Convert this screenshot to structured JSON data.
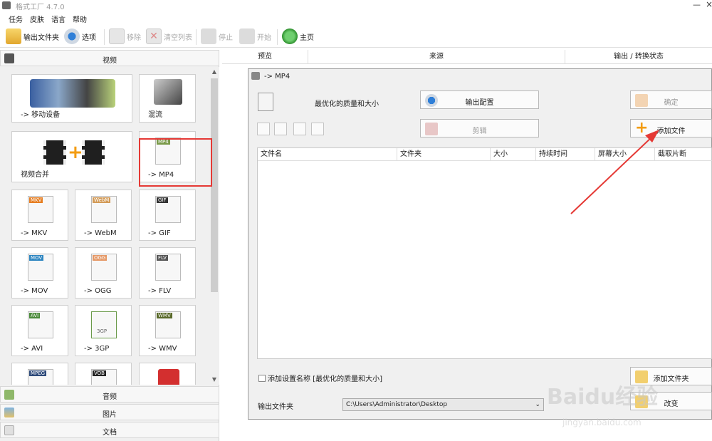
{
  "window": {
    "title": "格式工厂 4.7.0",
    "minimize": "—",
    "close": "×"
  },
  "menu": [
    "任务",
    "皮肤",
    "语言",
    "帮助"
  ],
  "toolbar": {
    "output_folder": "输出文件夹",
    "options": "选项",
    "remove": "移除",
    "clear_list": "清空列表",
    "stop": "停止",
    "start": "开始",
    "home": "主页"
  },
  "left": {
    "video_header": "视频",
    "tiles": [
      {
        "label": "-> 移动设备"
      },
      {
        "label": "混流"
      },
      {
        "label": "视频合并"
      },
      {
        "label": "-> MP4",
        "badge": "MP4"
      },
      {
        "label": "-> MKV",
        "badge": "MKV"
      },
      {
        "label": "-> WebM",
        "badge": "WebM"
      },
      {
        "label": "-> GIF",
        "badge": "GIF"
      },
      {
        "label": "-> MOV",
        "badge": "MOV"
      },
      {
        "label": "-> OGG",
        "badge": "OGG"
      },
      {
        "label": "-> FLV",
        "badge": "FLV"
      },
      {
        "label": "-> AVI",
        "badge": "AVI"
      },
      {
        "label": "-> 3GP",
        "badge": "3GP"
      },
      {
        "label": "-> WMV",
        "badge": "WMV"
      },
      {
        "label": "",
        "badge": "MPEG"
      },
      {
        "label": "",
        "badge": "VOB"
      },
      {
        "label": "",
        "badge": ""
      }
    ],
    "categories": [
      "音频",
      "图片",
      "文档"
    ]
  },
  "columns": [
    "预览",
    "来源",
    "输出 / 转换状态"
  ],
  "dialog": {
    "title": "-> MP4",
    "quality": "最优化的质量和大小",
    "output_config": "输出配置",
    "ok": "确定",
    "clip": "剪辑",
    "add_file": "添加文件",
    "table_headers": [
      "文件名",
      "文件夹",
      "大小",
      "持续时间",
      "屏幕大小",
      "截取片断"
    ],
    "add_setting_name": "添加设置名称 [最优化的质量和大小]",
    "add_folder": "添加文件夹",
    "output_folder_label": "输出文件夹",
    "output_path": "C:\\Users\\Administrator\\Desktop",
    "change": "改变"
  },
  "watermark": {
    "text": "Baidu经验",
    "sub": "jingyan.baidu.com"
  },
  "colors": {
    "highlight": "#e53935",
    "arrow": "#e53935",
    "accent_orange": "#f39c12"
  }
}
